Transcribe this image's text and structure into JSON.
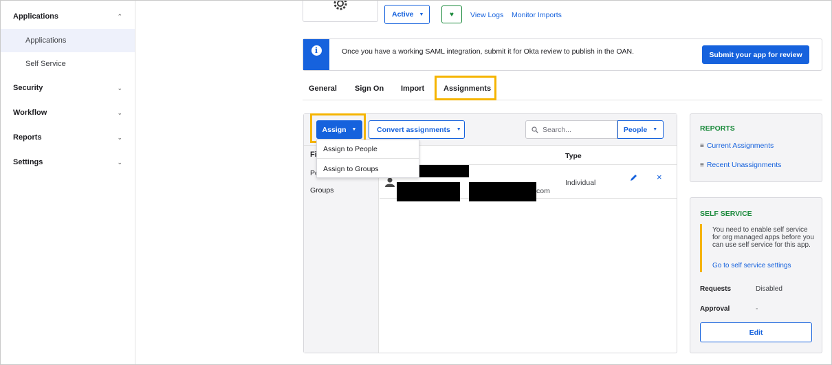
{
  "sidebar": {
    "applications_label": "Applications",
    "sub_items": [
      {
        "label": "Applications"
      },
      {
        "label": "Self Service"
      }
    ],
    "items": [
      {
        "label": "Security"
      },
      {
        "label": "Workflow"
      },
      {
        "label": "Reports"
      },
      {
        "label": "Settings"
      }
    ]
  },
  "header": {
    "status_label": "Active",
    "view_logs": "View Logs",
    "monitor_imports": "Monitor Imports"
  },
  "banner": {
    "message": "Once you have a working SAML integration, submit it for Okta review to publish in the OAN.",
    "submit_label": "Submit your app for review"
  },
  "tabs": [
    {
      "label": "General"
    },
    {
      "label": "Sign On"
    },
    {
      "label": "Import"
    },
    {
      "label": "Assignments"
    }
  ],
  "assignments": {
    "assign_label": "Assign",
    "convert_label": "Convert assignments",
    "search_placeholder": "Search...",
    "people_label": "People",
    "dropdown": [
      {
        "label": "Assign to People"
      },
      {
        "label": "Assign to Groups"
      }
    ],
    "filter_partial_1": "Fi",
    "filter_partial_2": "Pe",
    "filter_groups": "Groups",
    "type_header": "Type",
    "row": {
      "email_suffix": "com",
      "type": "Individual"
    }
  },
  "reports": {
    "title": "REPORTS",
    "current": "Current Assignments",
    "recent": "Recent Unassignments"
  },
  "self_service": {
    "title": "SELF SERVICE",
    "notice": "You need to enable self service for org managed apps before you can use self service for this app.",
    "settings_link": "Go to self service settings",
    "requests_label": "Requests",
    "requests_value": "Disabled",
    "approval_label": "Approval",
    "approval_value": "-",
    "edit_label": "Edit"
  },
  "colors": {
    "primary": "#1662dd",
    "highlight": "#f5b400",
    "card_title": "#1b8a3c",
    "notice_bar": "#f5b400"
  }
}
